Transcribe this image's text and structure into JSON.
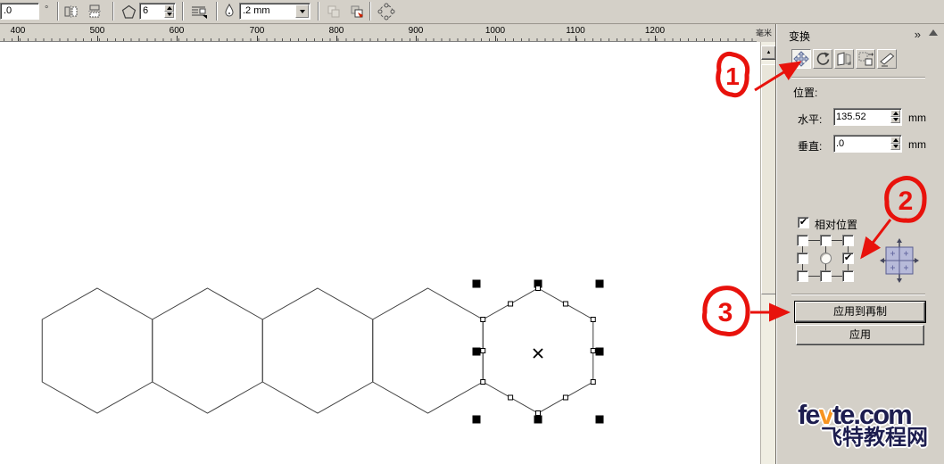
{
  "toolbar": {
    "angle_value": ".0",
    "angle_unit": "°",
    "polygon_points_value": "6",
    "outline_width_value": ".2 mm",
    "icons": [
      "flip-horizontal-icon",
      "flip-vertical-icon",
      "polygon-icon",
      "text-wrap-icon",
      "outline-pen-icon",
      "order-back-icon",
      "order-front-icon",
      "ring-nodes-icon"
    ]
  },
  "ruler": {
    "labels": [
      "400",
      "500",
      "600",
      "700",
      "800",
      "900",
      "1000",
      "1100",
      "1200"
    ],
    "unit": "毫米"
  },
  "scrollbar": {
    "up_arrow": "▲"
  },
  "panel": {
    "title": "变换",
    "expand_icon": "»",
    "tools": [
      "position",
      "rotate",
      "scale-mirror",
      "size",
      "skew"
    ],
    "active_tool": "position",
    "position_label": "位置:",
    "horizontal_label": "水平:",
    "horizontal_value": "135.52",
    "horizontal_unit": "mm",
    "vertical_label": "垂直:",
    "vertical_value": ".0",
    "vertical_unit": "mm",
    "relative_position_label": "相对位置",
    "relative_position_check": "✔",
    "anchor_grid": {
      "checked_cell": "middle-right",
      "check_glyph": "✔"
    },
    "apply_to_duplicate_label": "应用到再制",
    "apply_label": "应用"
  },
  "canvas": {
    "hexagon_count": 5,
    "selected_hexagon_index": 5
  },
  "annotations": [
    {
      "number": "1",
      "points_to": "position-tool-button"
    },
    {
      "number": "2",
      "points_to": "anchor-middle-right-checkbox"
    },
    {
      "number": "3",
      "points_to": "apply-to-duplicate-button"
    }
  ],
  "logo": {
    "part1": "fe",
    "part2": "v",
    "part3": "te.com",
    "line2": "飞特教程网"
  },
  "colors": {
    "chrome": "#d4d0c8",
    "canvas": "#ffffff",
    "annotation_red": "#e8120c",
    "logo_navy": "#1d1d4f",
    "logo_orange": "#f79421",
    "grid_icon_blue": "#b7bad9"
  }
}
